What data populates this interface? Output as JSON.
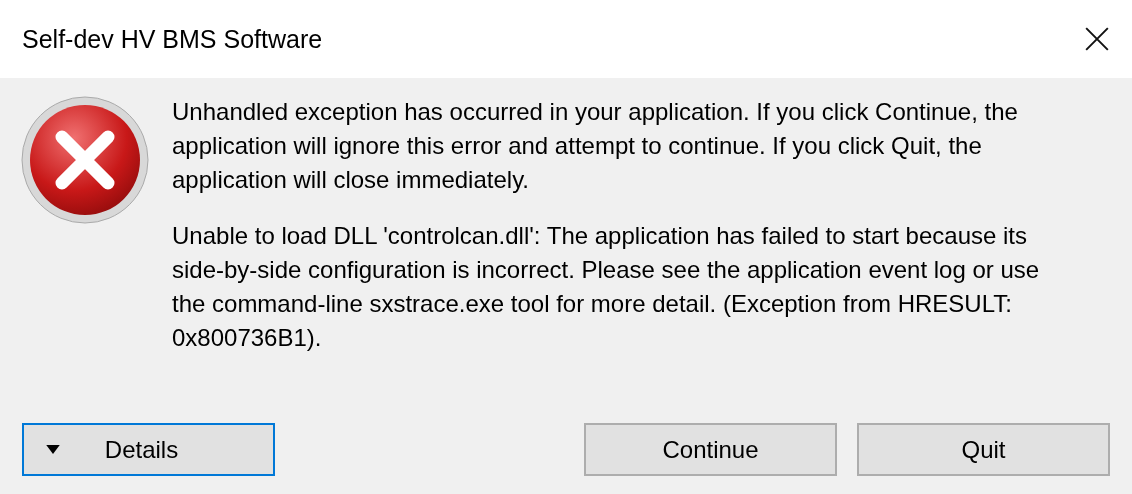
{
  "window": {
    "title": "Self-dev HV BMS Software"
  },
  "message": {
    "paragraphs": [
      "Unhandled exception has occurred in your application. If you click Continue, the application will ignore this error and attempt to continue. If you click Quit, the application will close immediately.",
      "Unable to load DLL 'controlcan.dll': The application has failed to start because its side-by-side configuration is incorrect. Please see the application event log or use the command-line sxstrace.exe tool for more detail. (Exception from HRESULT: 0x800736B1)."
    ]
  },
  "buttons": [
    {
      "label": "Details",
      "kind": "expander",
      "focused": true
    },
    {
      "label": "Continue",
      "kind": "plain",
      "focused": false
    },
    {
      "label": "Quit",
      "kind": "plain",
      "focused": false
    }
  ]
}
